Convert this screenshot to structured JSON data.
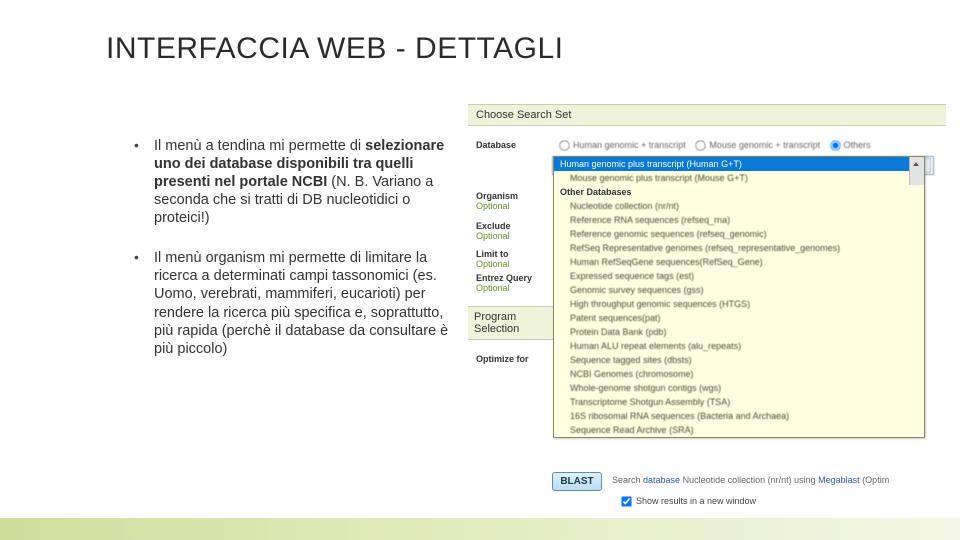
{
  "title": "INTERFACCIA WEB - DETTAGLI",
  "bullets": [
    {
      "lead": "Il menù a tendina mi permette di ",
      "bold": "selezionare uno dei database disponibili tra quelli presenti nel portale NCBI",
      "tail": " (N. B. Variano a seconda che si tratti di DB nucleotidici o proteici!)"
    },
    {
      "lead": "Il menù organism mi permette di limitare la ricerca a determinati campi tassonomici (es. Uomo, verebrati, mammiferi, eucarioti) per rendere la ricerca più specifica e, soprattutto, più rapida (perchè il database da consultare è più piccolo)",
      "bold": "",
      "tail": ""
    }
  ],
  "panel": {
    "section1": "Choose Search Set",
    "labels": {
      "database": "Database",
      "organism": "Organism",
      "exclude": "Exclude",
      "limit": "Limit to",
      "entrez": "Entrez Query",
      "optional": "Optional",
      "program": "Program Selection",
      "optimize": "Optimize for"
    },
    "radios": {
      "r1": "Human genomic + transcript",
      "r2": "Mouse genomic + transcript",
      "r3": "Others"
    },
    "select_value": "Nucleotide collection (nr/nt)"
  },
  "dropdown": {
    "selected": "Human genomic plus transcript (Human G+T)",
    "items": [
      {
        "t": "Human genomic plus transcript (Human G+T)",
        "cls": "selected"
      },
      {
        "t": "Mouse genomic plus transcript (Mouse G+T)",
        "cls": "child"
      },
      {
        "t": "Other Databases",
        "cls": "group"
      },
      {
        "t": "Nucleotide collection (nr/nt)",
        "cls": "child"
      },
      {
        "t": "Reference RNA sequences (refseq_rna)",
        "cls": "child"
      },
      {
        "t": "Reference genomic sequences (refseq_genomic)",
        "cls": "child"
      },
      {
        "t": "RefSeq Representative genomes (refseq_representative_genomes)",
        "cls": "child"
      },
      {
        "t": "Human RefSeqGene sequences(RefSeq_Gene)",
        "cls": "child"
      },
      {
        "t": "Expressed sequence tags (est)",
        "cls": "child"
      },
      {
        "t": "Genomic survey sequences (gss)",
        "cls": "child"
      },
      {
        "t": "High throughput genomic sequences (HTGS)",
        "cls": "child"
      },
      {
        "t": "Patent sequences(pat)",
        "cls": "child"
      },
      {
        "t": "Protein Data Bank (pdb)",
        "cls": "child"
      },
      {
        "t": "Human ALU repeat elements (alu_repeats)",
        "cls": "child"
      },
      {
        "t": "Sequence tagged sites (dbsts)",
        "cls": "child"
      },
      {
        "t": "NCBI Genomes (chromosome)",
        "cls": "child"
      },
      {
        "t": "Whole-genome shotgun contigs (wgs)",
        "cls": "child"
      },
      {
        "t": "Transcriptome Shotgun Assembly (TSA)",
        "cls": "child"
      },
      {
        "t": "16S ribosomal RNA sequences (Bacteria and Archaea)",
        "cls": "child"
      },
      {
        "t": "Sequence Read Archive (SRA)",
        "cls": "child"
      }
    ]
  },
  "blast": "BLAST",
  "footer": {
    "text_pre": "Search ",
    "link1": "database",
    "mid": " Nucleotide collection (nr/nt) using ",
    "link2": "Megablast",
    "tail": " (Optim",
    "checkbox": "Show results in a new window"
  }
}
